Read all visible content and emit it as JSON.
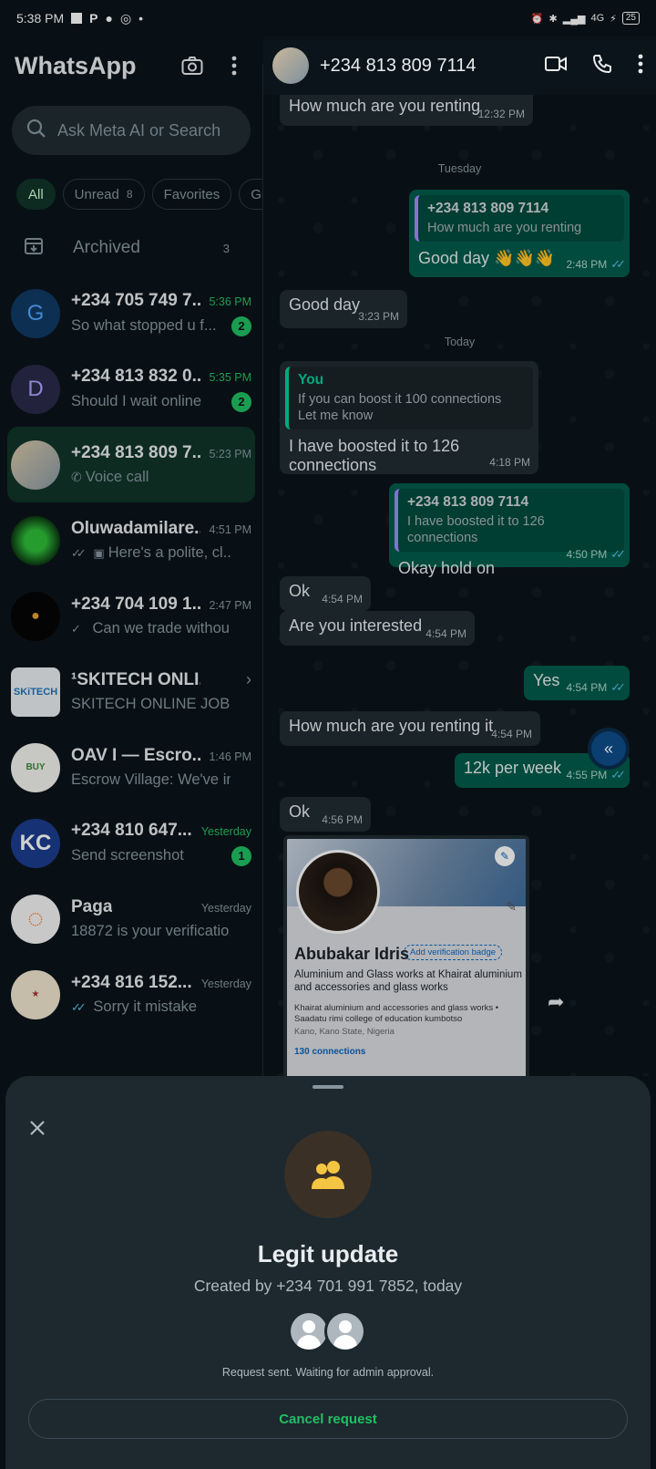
{
  "status_bar": {
    "time": "5:38 PM",
    "battery": "25"
  },
  "app": {
    "title": "WhatsApp"
  },
  "search": {
    "placeholder": "Ask Meta AI or Search"
  },
  "filters": [
    {
      "label": "All"
    },
    {
      "label": "Unread",
      "count": "8"
    },
    {
      "label": "Favorites"
    },
    {
      "label": "Gro"
    }
  ],
  "archived": {
    "label": "Archived",
    "count": "3"
  },
  "chats": [
    {
      "name": "+234 705 749 7...",
      "time": "5:36 PM",
      "preview": "So what stopped u f...",
      "badge": "2",
      "initial": "G",
      "avatar_color": "#103a64",
      "initial_color": "#53a6ff",
      "time_green": true
    },
    {
      "name": "+234 813 832 0...",
      "time": "5:35 PM",
      "preview": "Should I wait online",
      "badge": "2",
      "initial": "D",
      "avatar_color": "#2b2a4a",
      "initial_color": "#a9a7ff",
      "time_green": true
    },
    {
      "name": "+234 813 809 7...",
      "time": "5:23 PM",
      "preview": "Voice call",
      "selected": true
    },
    {
      "name": "Oluwadamilare...",
      "time": "4:51 PM",
      "preview": "Here's a polite, cl..."
    },
    {
      "name": "+234 704 109 1...",
      "time": "2:47 PM",
      "preview": "Can we trade withou..."
    },
    {
      "name": "¹SKITECH ONLI...",
      "time": "",
      "preview": "SKITECH ONLINE JOBS..."
    },
    {
      "name": "OAV I — Escro...",
      "time": "1:46 PM",
      "preview": "Escrow Village: We've in..."
    },
    {
      "name": "+234 810 647...",
      "time": "Yesterday",
      "preview": "Send screenshot",
      "badge": "1",
      "time_green": true
    },
    {
      "name": "Paga",
      "time": "Yesterday",
      "preview": "18872 is your verificatio..."
    },
    {
      "name": "+234 816 152...",
      "time": "Yesterday",
      "preview": "Sorry it mistake"
    }
  ],
  "conversation": {
    "title": "+234 813 809 7114",
    "messages": {
      "m1": {
        "text": "How much are you renting",
        "time": "12:32 PM"
      },
      "day1": "Tuesday",
      "m2": {
        "quote_name": "+234 813 809 7114",
        "quote_text": "How much are you renting",
        "text": "Good day 👋👋👋",
        "time": "2:48 PM"
      },
      "m3": {
        "text": "Good day",
        "time": "3:23 PM"
      },
      "day2": "Today",
      "m4": {
        "quote_name": "You",
        "quote_text": "If you can boost it 100 connections\nLet me know",
        "text": "I have boosted it to 126 connections",
        "time": "4:18 PM"
      },
      "m5": {
        "quote_name": "+234 813 809 7114",
        "quote_text": "I have boosted it to 126 connections",
        "text": "Okay hold on",
        "time": "4:50 PM"
      },
      "m6": {
        "text": "Ok",
        "time": "4:54 PM"
      },
      "m7": {
        "text": "Are you interested",
        "time": "4:54 PM"
      },
      "m8": {
        "text": "Yes",
        "time": "4:54 PM"
      },
      "m9": {
        "text": "How much are you renting it",
        "time": "4:54 PM"
      },
      "m10": {
        "text": "12k per week",
        "time": "4:55 PM"
      },
      "m11": {
        "text": "Ok",
        "time": "4:56 PM"
      }
    },
    "image_card": {
      "name": "Abubakar Idris",
      "verify_badge": "Add verification badge",
      "headline": "Aluminium and Glass works at Khairat aluminium and accessories and glass works",
      "experience": "Khairat aluminium and accessories and glass works • Saadatu rimi college of education kumbotso",
      "location": "Kano, Kano State, Nigeria",
      "connections": "130 connections"
    }
  },
  "sheet": {
    "title": "Legit update",
    "subtitle": "Created by +234 701 991 7852, today",
    "status": "Request sent. Waiting for admin approval.",
    "cancel_label": "Cancel request"
  },
  "colors": {
    "accent": "#21c063",
    "outgoing": "#005c4b",
    "incoming": "#202c33",
    "background": "#0b141a"
  }
}
